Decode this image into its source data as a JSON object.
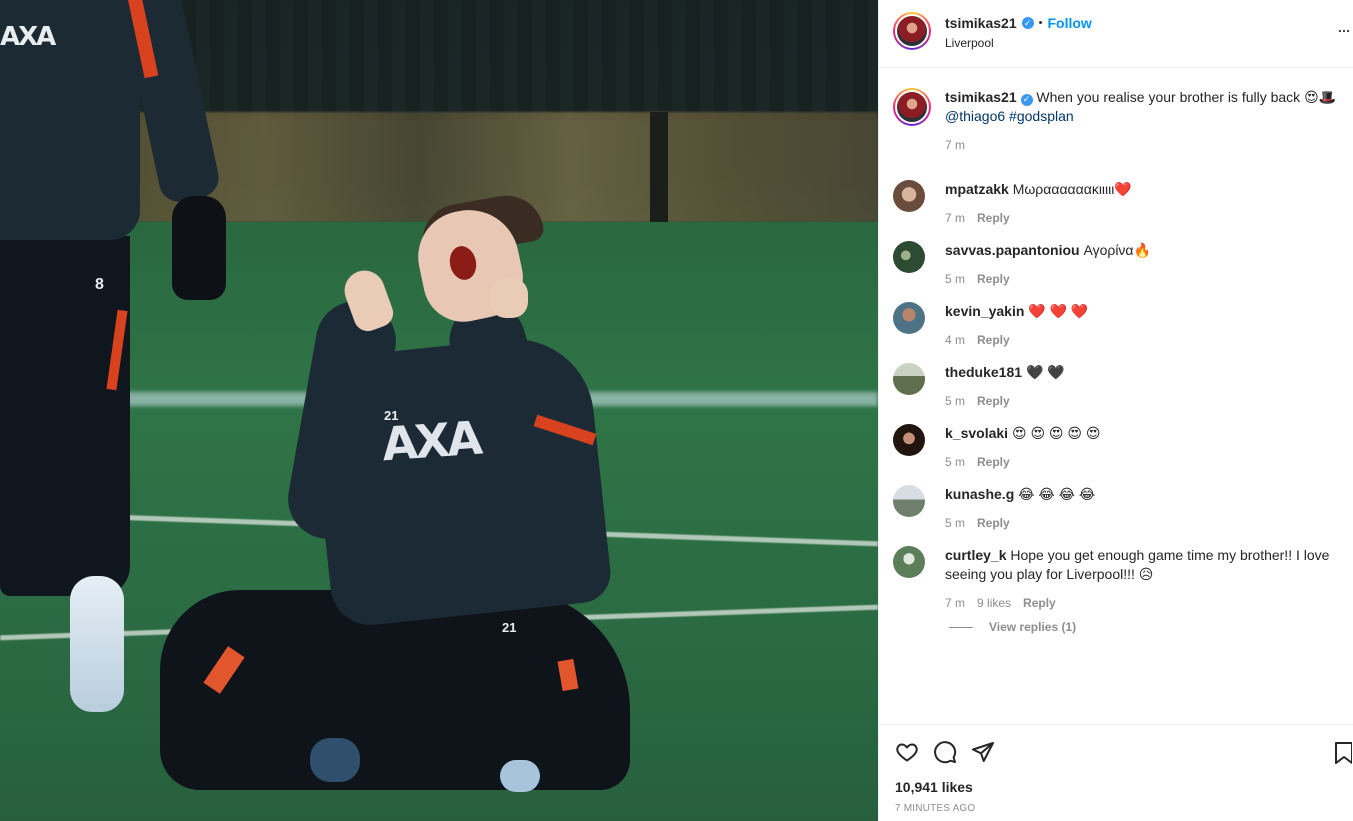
{
  "post": {
    "author": "tsimikas21",
    "follow_label": "Follow",
    "separator": "•",
    "location": "Liverpool",
    "caption": {
      "username": "tsimikas21",
      "text": "When you realise your brother is fully back 😍🎩",
      "mention": "@thiago6",
      "hashtag": "#godsplan",
      "time": "7 m"
    },
    "more_label": "···",
    "likes": "10,941 likes",
    "timestamp": "7 MINUTES AGO"
  },
  "labels": {
    "reply": "Reply",
    "view_replies": "View replies (1)"
  },
  "comments": [
    {
      "username": "mpatzakk",
      "text": "Μωραααααακιιιιι❤️",
      "time": "7 m",
      "likes": "",
      "avatar_color": "#7a5b4a"
    },
    {
      "username": "savvas.papantoniou",
      "text": "Αγορίνα🔥",
      "time": "5 m",
      "likes": "",
      "avatar_color": "#2d4a32"
    },
    {
      "username": "kevin_yakin",
      "text": "❤️ ❤️ ❤️",
      "time": "4 m",
      "likes": "",
      "avatar_color": "#5a7a8f"
    },
    {
      "username": "theduke181",
      "text": "🖤 🖤",
      "time": "5 m",
      "likes": "",
      "avatar_color": "#6f7d5e"
    },
    {
      "username": "k_svolaki",
      "text": "😍 😍 😍 😍 😍",
      "time": "5 m",
      "likes": "",
      "avatar_color": "#2a1c18"
    },
    {
      "username": "kunashe.g",
      "text": "😂 😂 😂 😂",
      "time": "5 m",
      "likes": "",
      "avatar_color": "#8a9a88"
    },
    {
      "username": "curtley_k",
      "text": "Hope you get enough game time my brother!! I love seeing you play for Liverpool!!! 😥",
      "time": "7 m",
      "likes": "9 likes",
      "avatar_color": "#6d8a6a"
    }
  ],
  "media": {
    "logo": "AXA",
    "number_standing": "8",
    "number_kneeling": "21"
  },
  "colors": {
    "accent": "#0095f6",
    "link": "#00376b",
    "muted": "#8e8e8e",
    "verified": "#3897f0"
  }
}
